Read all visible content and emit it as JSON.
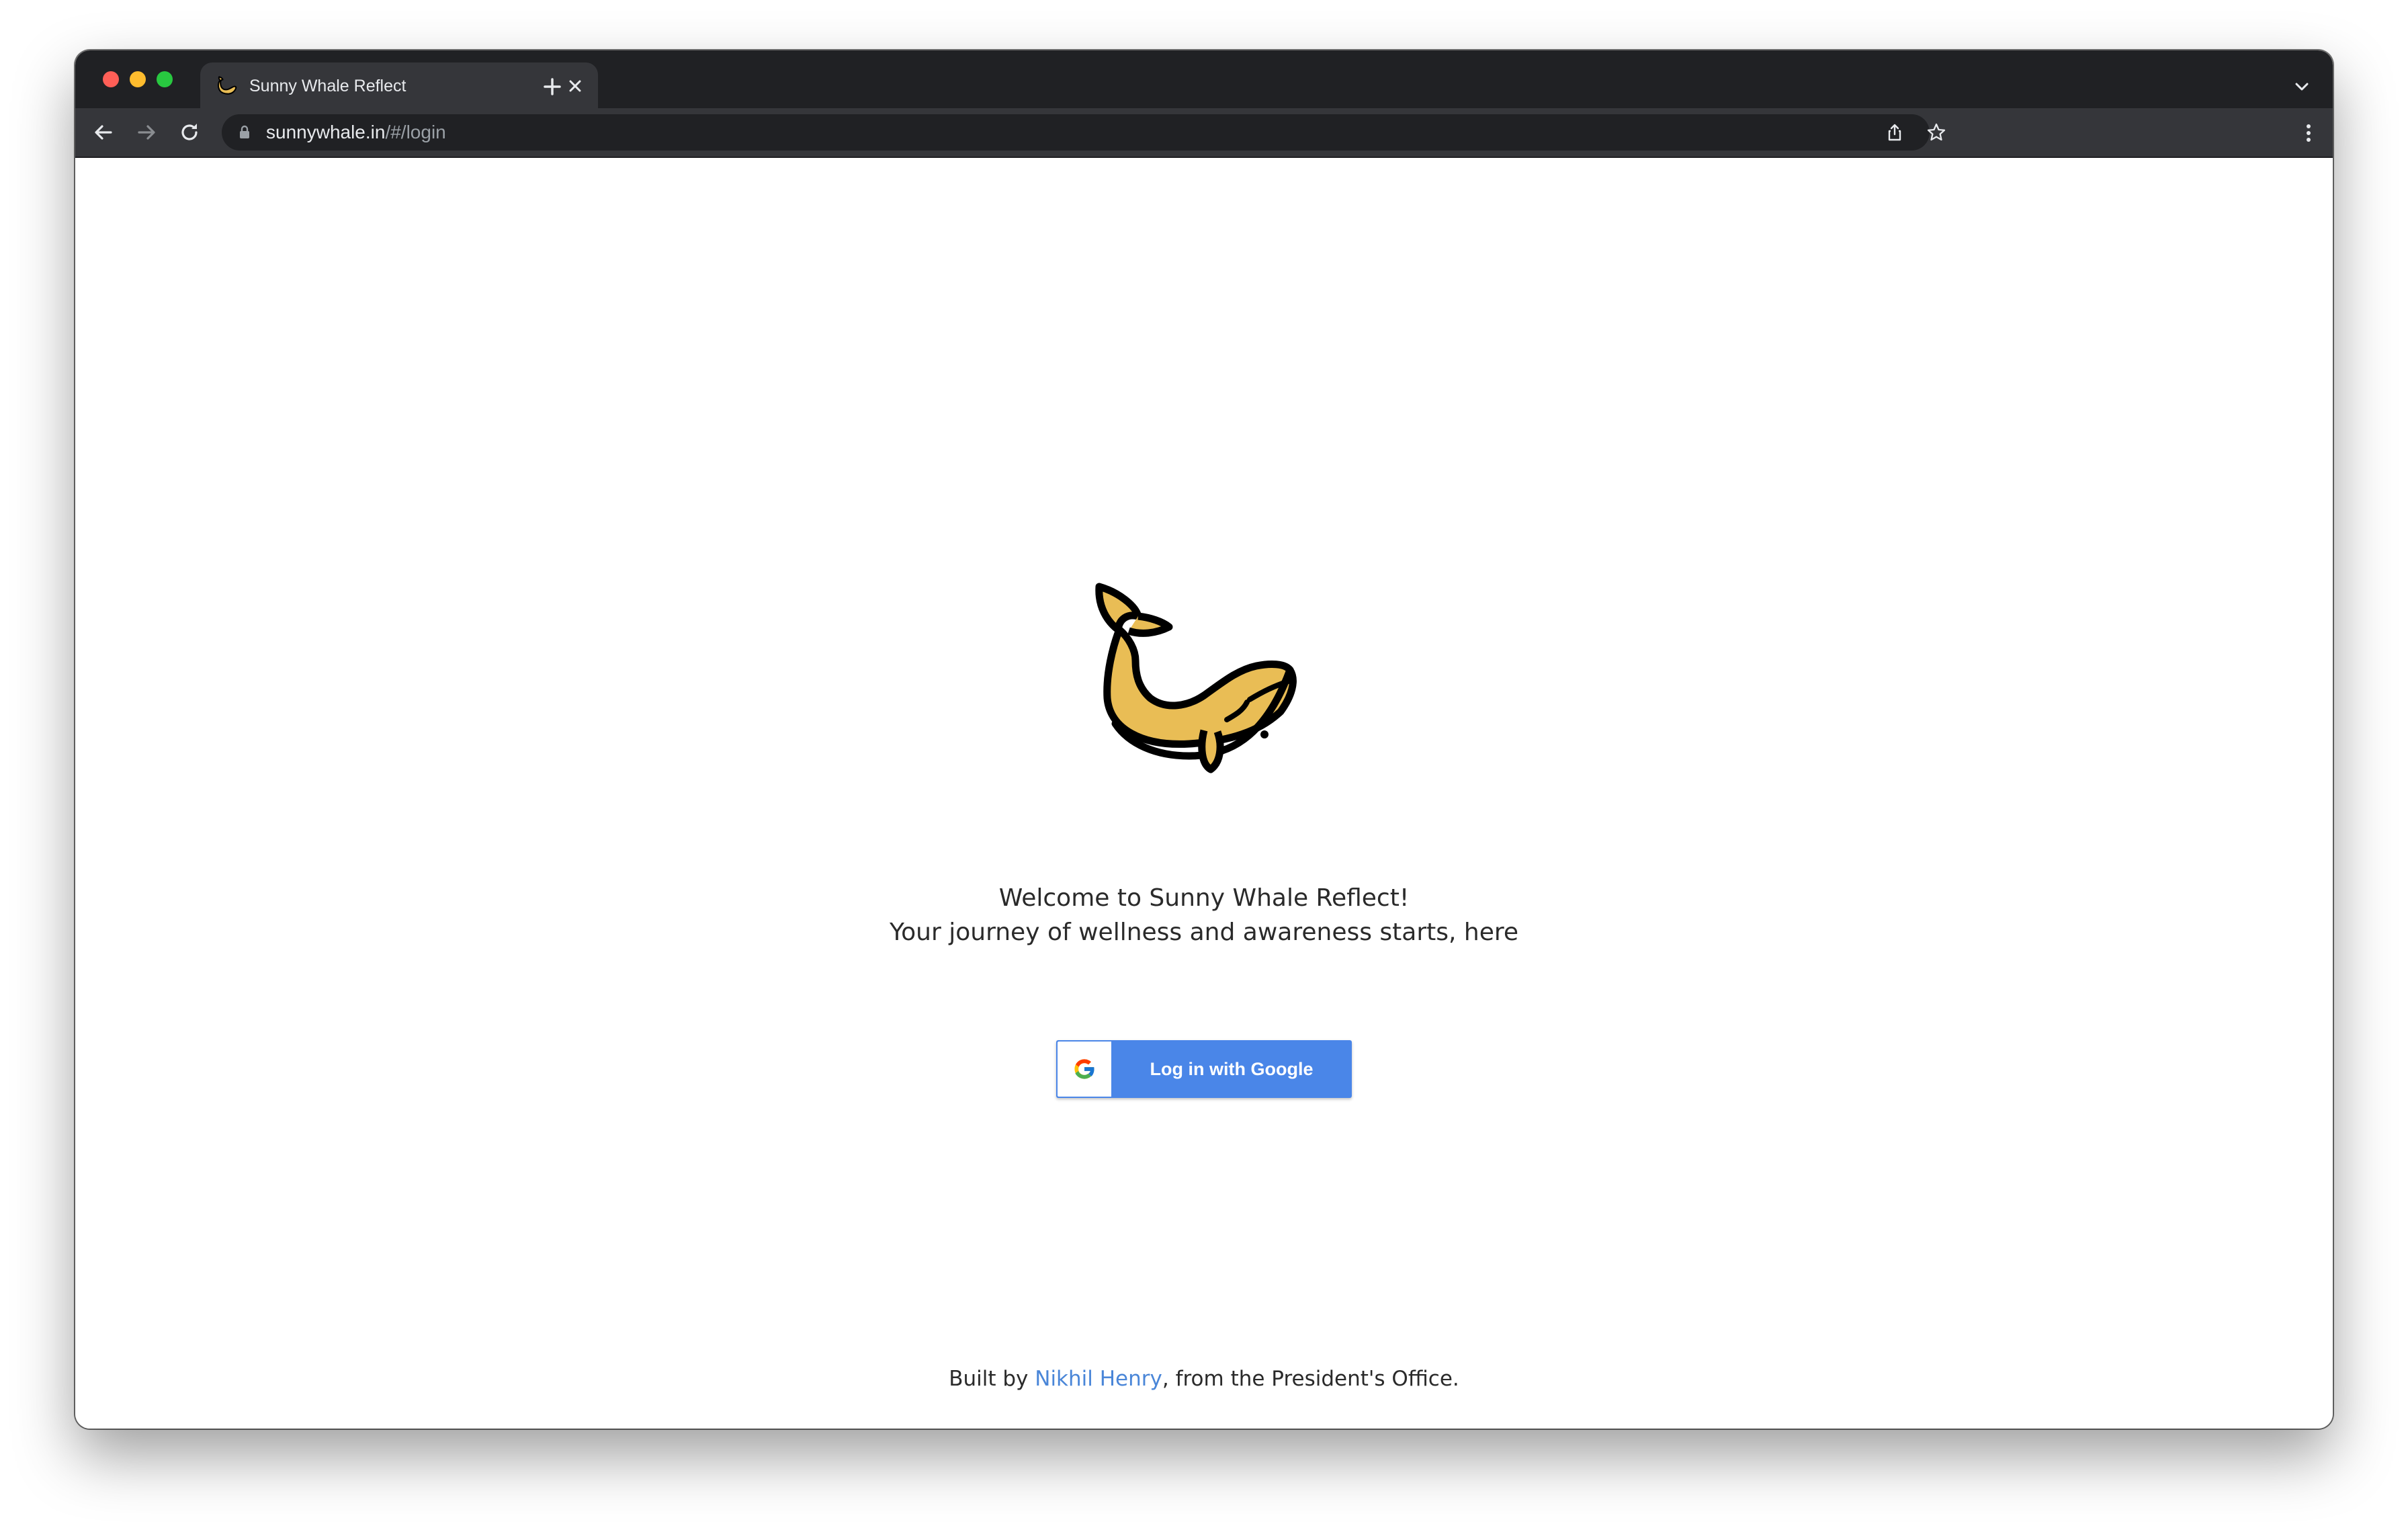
{
  "browser": {
    "tab_title": "Sunny Whale Reflect",
    "url_host": "sunnywhale.in",
    "url_path": "/#/login"
  },
  "page": {
    "welcome_line1": "Welcome to Sunny Whale Reflect!",
    "welcome_line2": "Your journey of wellness and awareness starts, here",
    "login_button_label": "Log in with Google",
    "footer_prefix": "Built by ",
    "footer_author": "Nikhil Henry",
    "footer_suffix": ", from the President's Office."
  },
  "icons": {
    "logo": "whale-logo",
    "login_button": "google-g-icon"
  },
  "colors": {
    "accent": "#4a86e8",
    "logo_fill": "#e9bd55",
    "link": "#4a86d8"
  }
}
